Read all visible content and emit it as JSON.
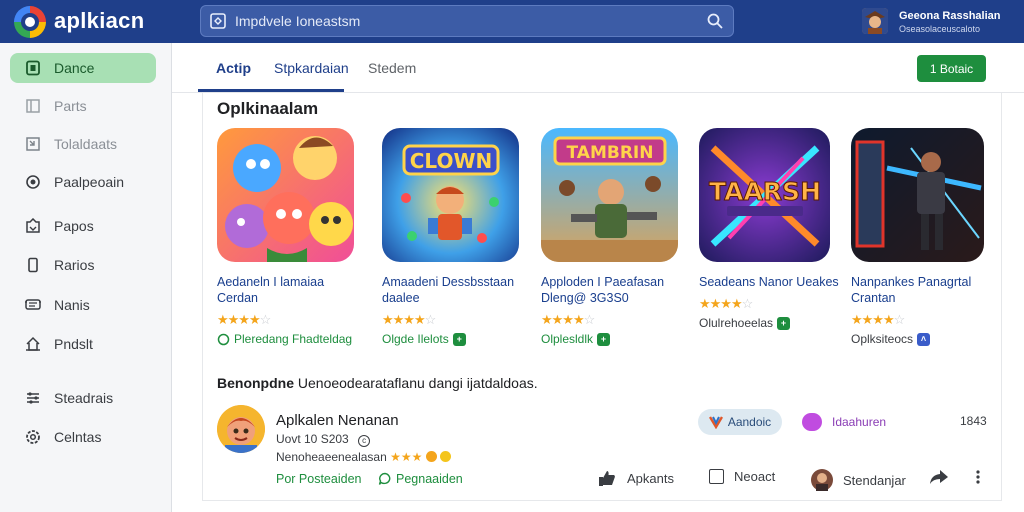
{
  "app": {
    "title": "aplkiacn",
    "colors": {
      "header": "#1f3f8a",
      "accent": "#1e8e3e",
      "link": "#1a3f8e"
    }
  },
  "search": {
    "placeholder": "Impdvele Ioneastsm",
    "value": ""
  },
  "user": {
    "name": "Geeona Rasshalian",
    "subtitle": "Oseasolaceuscaloto"
  },
  "sidebar": {
    "items": [
      {
        "label": "Dance",
        "icon": "apps-icon",
        "active": true
      },
      {
        "label": "Parts",
        "icon": "frame-icon",
        "dim": true
      },
      {
        "label": "Tolaldaats",
        "icon": "tag-icon",
        "dim": true
      },
      {
        "label": "Paalpeoain",
        "icon": "refresh-icon"
      },
      {
        "label": "Papos",
        "icon": "inbox-icon"
      },
      {
        "label": "Rarios",
        "icon": "phone-icon"
      },
      {
        "label": "Nanis",
        "icon": "chat-icon"
      },
      {
        "label": "Pndslt",
        "icon": "home-icon"
      },
      {
        "label": "Steadrais",
        "icon": "sliders-icon"
      },
      {
        "label": "Celntas",
        "icon": "settings-icon"
      }
    ]
  },
  "tabs": [
    {
      "label": "Actip",
      "active": true
    },
    {
      "label": "Stpkardaian",
      "active": false
    },
    {
      "label": "Stedem",
      "active": false
    }
  ],
  "install_button": {
    "label": "1 Botaic"
  },
  "section": {
    "title": "Oplkinaalam"
  },
  "apps": [
    {
      "name": "Aedaneln I lamaiaa Cerdan",
      "rating": 4,
      "tag": "Pleredang Fhadteldag",
      "tag_color": "#1e8e3e",
      "icon": "cartoon-heroes-icon"
    },
    {
      "name": "Amaadeni Dessbsstaan daalee",
      "rating": 4,
      "tag": "Olgde Ilelots",
      "tag_color": "#1e8e3e",
      "icon": "clown-game-icon"
    },
    {
      "name": "Apploden I Paeafasan Dleng@ 3G3S0",
      "rating": 4,
      "tag": "Olplesldlk",
      "tag_color": "#1e8e3e",
      "icon": "tambrin-battle-icon"
    },
    {
      "name": "Seadeans Nanor Ueakes",
      "rating": 4,
      "tag": "Olulrehoeelas",
      "tag_color": "#3a3d42",
      "icon": "taarsh-swords-icon"
    },
    {
      "name": "Nanpankes Panagrtal Crantan",
      "rating": 4,
      "tag": "Oplksiteocs",
      "tag_color": "#3a3d42",
      "icon": "cyber-warrior-icon"
    }
  ],
  "recommendation": {
    "prefix": "Benonpdne",
    "text": "Uenoeodearataflanu dangi ijatdaldoas."
  },
  "review": {
    "name": "Aplkalen Nenanan",
    "version": "Uovt 10 S203",
    "rating_text": "Nenoheaeenealasan",
    "stars": "★★★",
    "link1": "Por Posteaiden",
    "link2": "Pegnaaiden",
    "chip1": "Aandoic",
    "chip2": "Idaahuren",
    "page_count": "1843"
  },
  "actions": [
    {
      "label": "Apkants",
      "icon": "thumbs-icon"
    },
    {
      "label": "Neoact",
      "icon": "checkbox-icon"
    },
    {
      "label": "Stendanjar",
      "icon": "avatar-icon"
    }
  ]
}
